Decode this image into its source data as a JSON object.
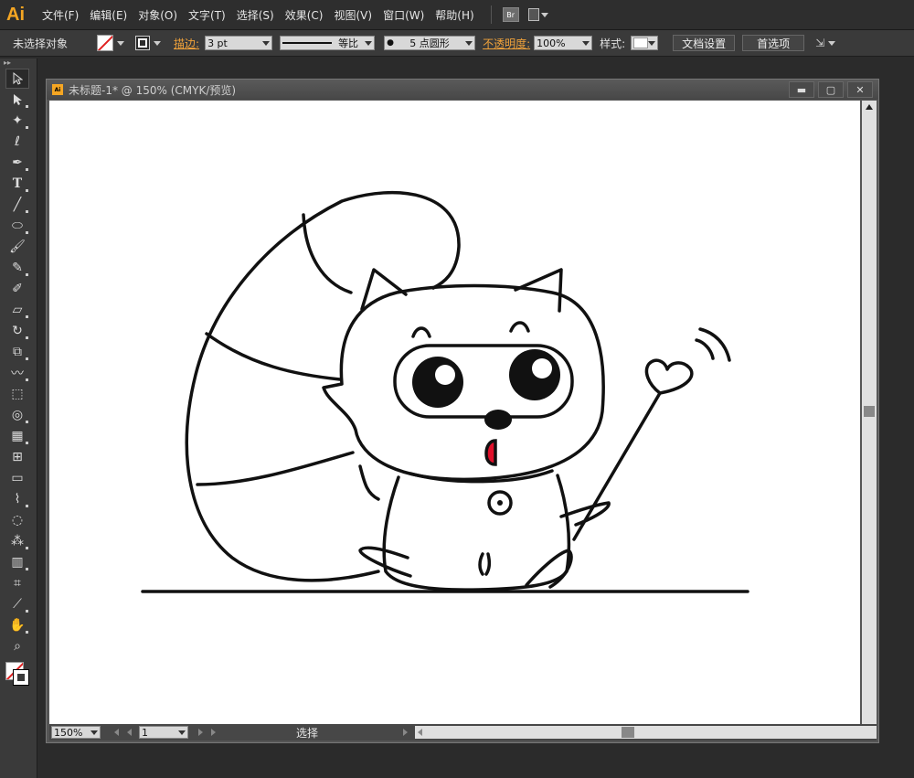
{
  "app": {
    "logo": "Ai"
  },
  "menu": {
    "items": [
      "文件(F)",
      "编辑(E)",
      "对象(O)",
      "文字(T)",
      "选择(S)",
      "效果(C)",
      "视图(V)",
      "窗口(W)",
      "帮助(H)"
    ],
    "bridge_label": "Br"
  },
  "control": {
    "selection_label": "未选择对象",
    "stroke_label": "描边:",
    "stroke_weight": "3 pt",
    "profile_label": "等比",
    "brush_label": "5 点圆形",
    "opacity_label": "不透明度:",
    "opacity_value": "100%",
    "style_label": "样式:",
    "doc_setup_button": "文档设置",
    "preferences_button": "首选项"
  },
  "tools": {
    "collapse": "▸▸"
  },
  "document": {
    "title": "未标题-1* @ 150% (CMYK/预览)",
    "doc_icon": "Ai",
    "min_symbol": "▬",
    "max_symbol": "▢",
    "close_symbol": "✕"
  },
  "status": {
    "zoom": "150%",
    "artboard": "1",
    "tool_status": "选择"
  },
  "colors": {
    "accent": "#f5a623",
    "mouth_red": "#e0102a",
    "panel_bg": "#3a3a3a",
    "canvas_bg": "#ffffff"
  }
}
